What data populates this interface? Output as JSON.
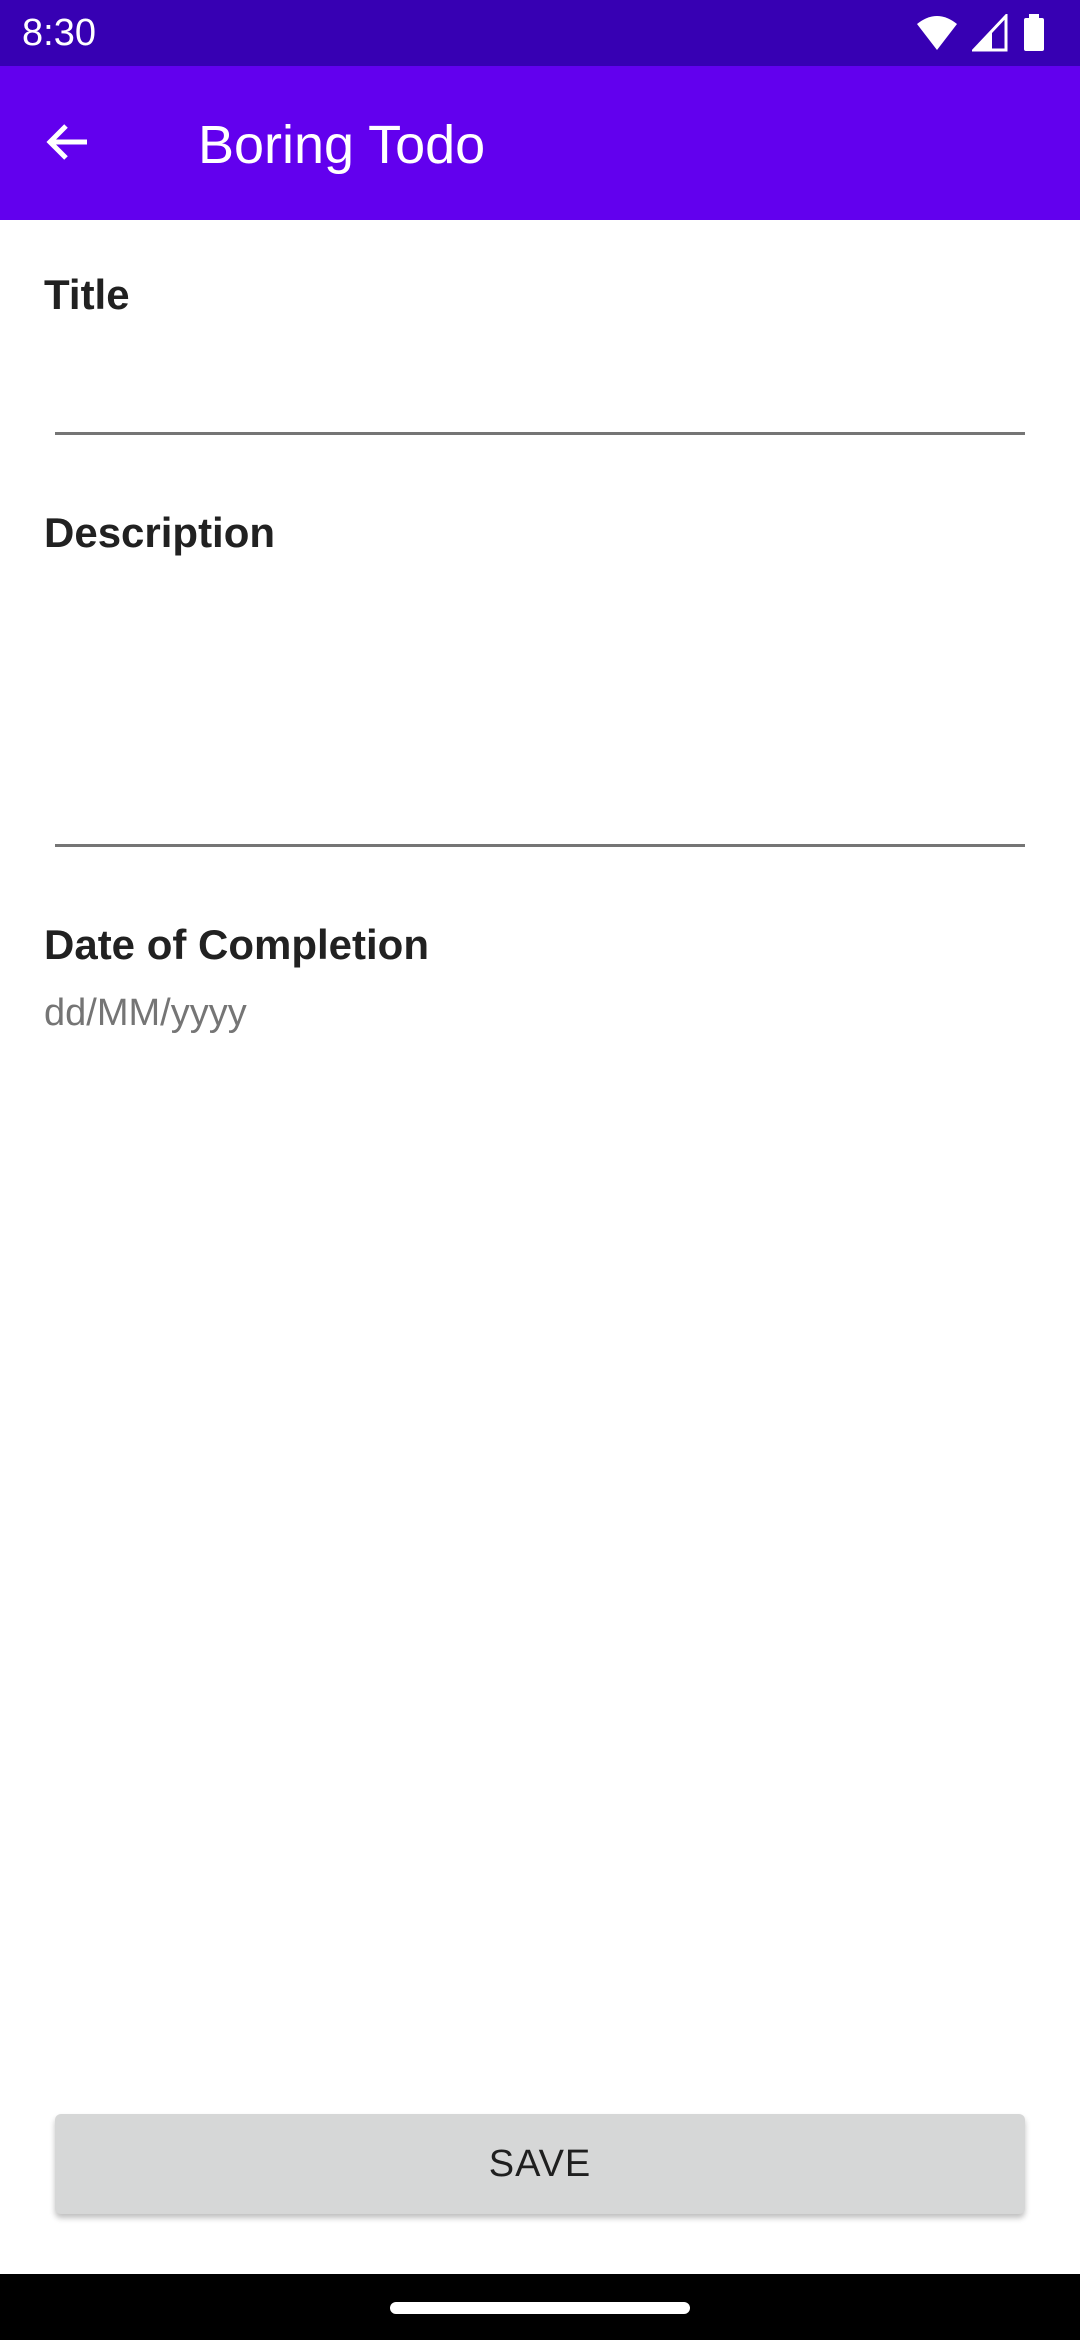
{
  "status_bar": {
    "time": "8:30",
    "icons": [
      "wifi-icon",
      "cellular-signal-icon",
      "battery-icon"
    ],
    "background": "#3700b3"
  },
  "app_bar": {
    "title": "Boring Todo",
    "back_icon": "arrow-back-icon",
    "background": "#6200ee"
  },
  "form": {
    "title_label": "Title",
    "title_value": "",
    "description_label": "Description",
    "description_value": "",
    "date_label": "Date of Completion",
    "date_placeholder": "dd/MM/yyyy"
  },
  "actions": {
    "save_label": "SAVE"
  },
  "nav_bar": {
    "handle": "gesture-handle"
  }
}
